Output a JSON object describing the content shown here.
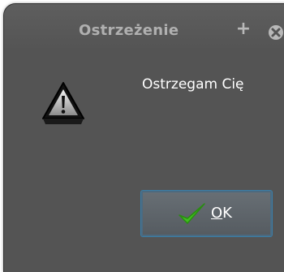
{
  "dialog": {
    "title": "Ostrzeżenie",
    "maximize_symbol": "+",
    "message": "Ostrzegam Cię",
    "ok_mnemonic": "O",
    "ok_rest": "K"
  },
  "icons": {
    "warning": "warning-triangle-icon",
    "check": "checkmark-icon",
    "close": "close-circle-icon"
  },
  "colors": {
    "window_bg": "#545454",
    "title_text": "#b0b0b0",
    "button_border": "#3a7ea8",
    "check_green": "#3fbf1f"
  }
}
